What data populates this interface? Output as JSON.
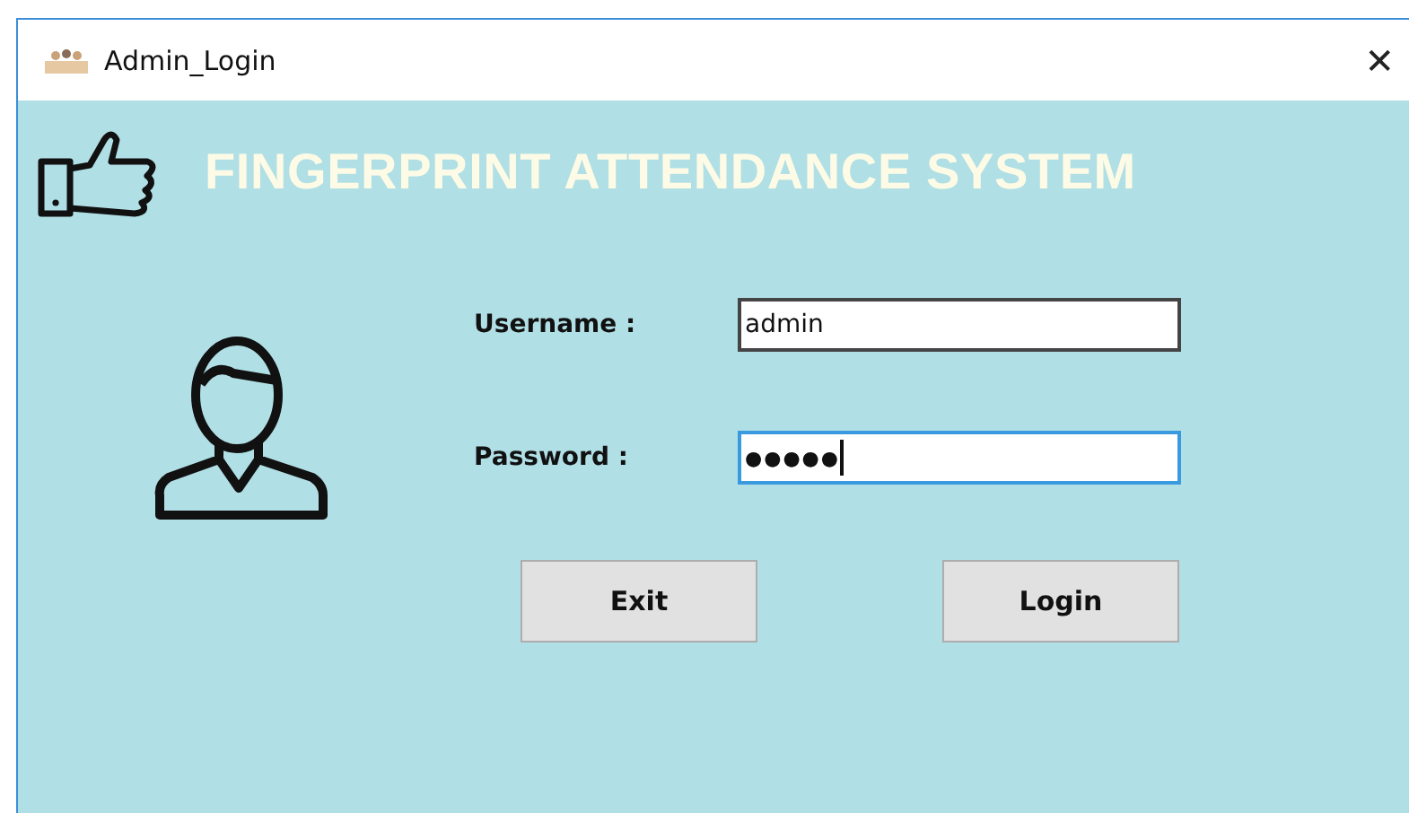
{
  "window": {
    "title": "Admin_Login",
    "close": "✕"
  },
  "header": {
    "title": "FINGERPRINT ATTENDANCE SYSTEM"
  },
  "fields": [
    {
      "label": "Username :",
      "value": "admin",
      "focused": false
    },
    {
      "label": "Password :",
      "value": "●●●●●",
      "focused": true
    }
  ],
  "buttons": [
    "Exit",
    "Login"
  ]
}
